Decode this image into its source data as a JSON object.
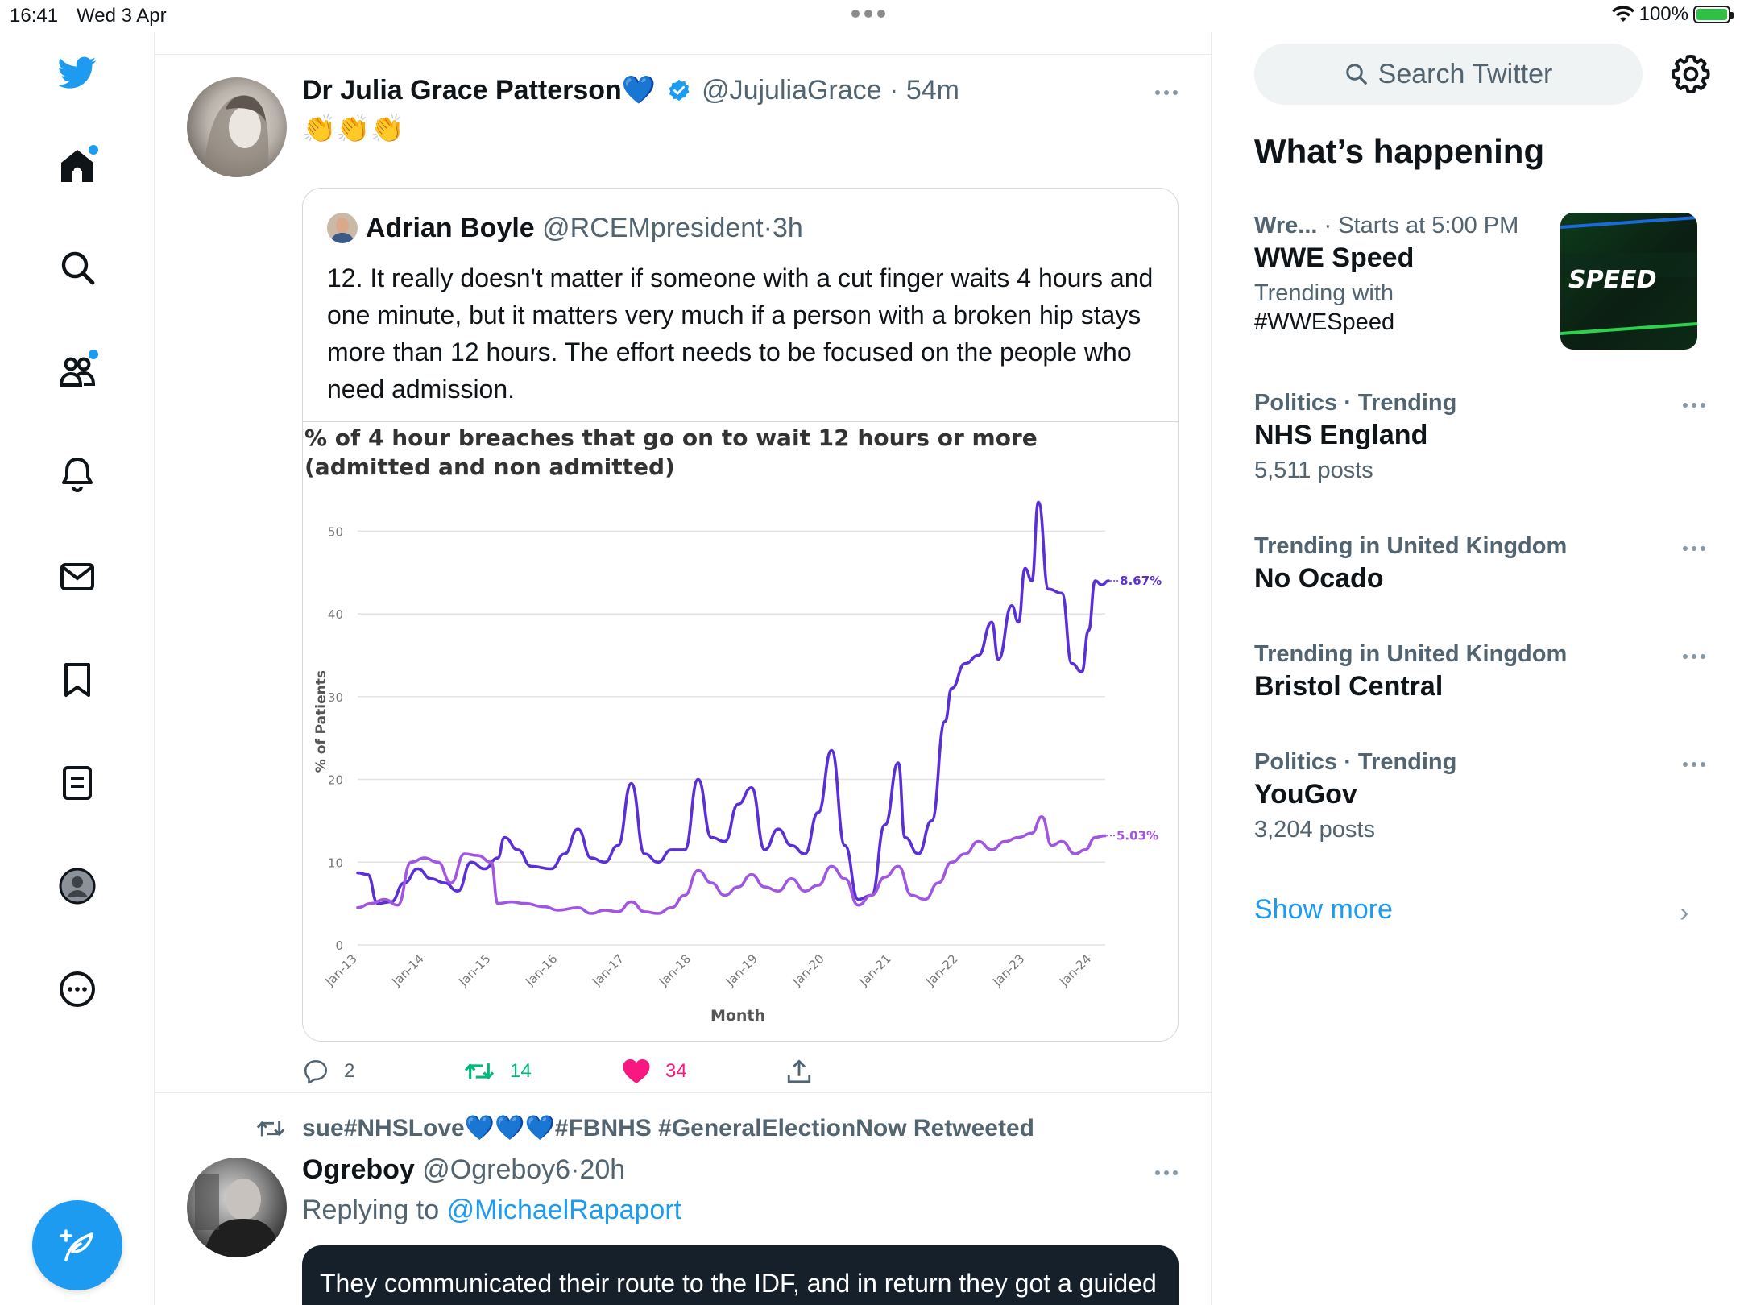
{
  "status_bar": {
    "time": "16:41",
    "date": "Wed 3 Apr",
    "battery": "100%"
  },
  "colors": {
    "accent": "#1d9bf0",
    "like": "#f91880",
    "retweet": "#00ba7c",
    "series_dark": "#5a2fd6",
    "series_light": "#a056e0"
  },
  "nav": {
    "icons": [
      "twitter-logo-icon",
      "home-icon",
      "explore-icon",
      "communities-icon",
      "notifications-icon",
      "messages-icon",
      "bookmarks-icon",
      "lists-icon",
      "profile-icon",
      "more-icon"
    ],
    "compose_icon": "compose-tweet-icon"
  },
  "tweet1": {
    "name": "Dr Julia Grace Patterson",
    "name_emoji": "💙",
    "handle": "@JujuliaGrace",
    "sep": "·",
    "time": "54m",
    "text": "👏👏👏",
    "quote": {
      "name": "Adrian Boyle",
      "handle": "@RCEMpresident",
      "sep": "·",
      "time": "3h",
      "text": "12. It really doesn't matter if someone with a cut finger waits 4 hours and one minute, but it matters very much if a person with a broken hip stays more than 12 hours. The effort needs to be focused on the people who need admission."
    },
    "actions": {
      "replies": "2",
      "retweets": "14",
      "likes": "34"
    }
  },
  "tweet2": {
    "retweeted_by": "sue#NHSLove💙💙💙#FBNHS #GeneralElectionNow Retweeted",
    "name": "Ogreboy",
    "handle": "@Ogreboy6",
    "sep": "·",
    "time": "20h",
    "replying_prefix": "Replying to",
    "replying_to": "@MichaelRapaport",
    "card_text": "They communicated their route to the IDF, and in return they got a guided munition literally straight through the logo identifying them, so"
  },
  "sidebar": {
    "search_placeholder": "Search Twitter",
    "title": "What’s happening",
    "trends": [
      {
        "meta": "Wre...",
        "meta_extra": "· Starts at 5:00 PM",
        "name": "WWE Speed",
        "sub": "Trending with",
        "sub2": "#WWESpeed",
        "image_label": "SPEED"
      },
      {
        "meta": "Politics · Trending",
        "name": "NHS England",
        "sub": "5,511 posts"
      },
      {
        "meta": "Trending in United Kingdom",
        "name": "No Ocado"
      },
      {
        "meta": "Trending in United Kingdom",
        "name": "Bristol Central"
      },
      {
        "meta": "Politics · Trending",
        "name": "YouGov",
        "sub": "3,204 posts"
      }
    ],
    "show_more": "Show more"
  },
  "chart_data": {
    "type": "line",
    "title": "% of 4 hour breaches that go on to wait 12 hours or more (admitted and non admitted)",
    "xlabel": "Month",
    "ylabel": "% of Patients",
    "ylim": [
      0,
      55
    ],
    "yticks": [
      0,
      10,
      20,
      30,
      40,
      50
    ],
    "x_tick_labels": [
      "Jan-13",
      "Jan-14",
      "Jan-15",
      "Jan-16",
      "Jan-17",
      "Jan-18",
      "Jan-19",
      "Jan-20",
      "Jan-21",
      "Jan-22",
      "Jan-23",
      "Jan-24"
    ],
    "grid": true,
    "legend": "none",
    "end_labels": [
      "8.67%",
      "5.03%"
    ],
    "series": [
      {
        "color": "#5a2fd6",
        "points": [
          [
            2013.0,
            8.7
          ],
          [
            2013.15,
            8.5
          ],
          [
            2013.3,
            5
          ],
          [
            2013.5,
            5.2
          ],
          [
            2013.7,
            7.5
          ],
          [
            2013.9,
            9.2
          ],
          [
            2014.1,
            8
          ],
          [
            2014.3,
            7.5
          ],
          [
            2014.5,
            6.5
          ],
          [
            2014.7,
            10
          ],
          [
            2014.9,
            9.2
          ],
          [
            2015.1,
            10.5
          ],
          [
            2015.2,
            13
          ],
          [
            2015.4,
            11.5
          ],
          [
            2015.6,
            9.5
          ],
          [
            2015.9,
            9.2
          ],
          [
            2016.1,
            11
          ],
          [
            2016.3,
            14
          ],
          [
            2016.5,
            10.5
          ],
          [
            2016.7,
            10
          ],
          [
            2016.9,
            12
          ],
          [
            2017.1,
            19.5
          ],
          [
            2017.3,
            11
          ],
          [
            2017.5,
            10
          ],
          [
            2017.7,
            11.5
          ],
          [
            2017.9,
            11.5
          ],
          [
            2018.1,
            20
          ],
          [
            2018.3,
            13
          ],
          [
            2018.5,
            12.5
          ],
          [
            2018.7,
            17
          ],
          [
            2018.9,
            19
          ],
          [
            2019.1,
            11.5
          ],
          [
            2019.3,
            14
          ],
          [
            2019.5,
            12
          ],
          [
            2019.7,
            11
          ],
          [
            2019.9,
            16
          ],
          [
            2020.1,
            23.5
          ],
          [
            2020.3,
            12
          ],
          [
            2020.5,
            5.5
          ],
          [
            2020.7,
            6
          ],
          [
            2020.9,
            14.5
          ],
          [
            2021.1,
            22
          ],
          [
            2021.2,
            13
          ],
          [
            2021.4,
            11
          ],
          [
            2021.6,
            15
          ],
          [
            2021.8,
            27
          ],
          [
            2021.9,
            31
          ],
          [
            2022.1,
            34
          ],
          [
            2022.3,
            35
          ],
          [
            2022.5,
            39
          ],
          [
            2022.6,
            34.5
          ],
          [
            2022.8,
            41
          ],
          [
            2022.9,
            39
          ],
          [
            2023.0,
            45.5
          ],
          [
            2023.1,
            44
          ],
          [
            2023.2,
            53.5
          ],
          [
            2023.35,
            43
          ],
          [
            2023.55,
            42.5
          ],
          [
            2023.7,
            34
          ],
          [
            2023.85,
            33
          ],
          [
            2023.95,
            38
          ],
          [
            2024.05,
            44
          ],
          [
            2024.15,
            43.5
          ],
          [
            2024.25,
            44
          ]
        ]
      },
      {
        "color": "#a056e0",
        "points": [
          [
            2013.0,
            4.5
          ],
          [
            2013.2,
            5
          ],
          [
            2013.4,
            5.5
          ],
          [
            2013.6,
            4.8
          ],
          [
            2013.8,
            10
          ],
          [
            2014.0,
            10.5
          ],
          [
            2014.2,
            10
          ],
          [
            2014.4,
            7.5
          ],
          [
            2014.6,
            11
          ],
          [
            2014.8,
            10.8
          ],
          [
            2015.0,
            10
          ],
          [
            2015.1,
            5
          ],
          [
            2015.3,
            5.2
          ],
          [
            2015.5,
            5
          ],
          [
            2015.8,
            4.6
          ],
          [
            2016.0,
            4.2
          ],
          [
            2016.3,
            4.5
          ],
          [
            2016.5,
            3.8
          ],
          [
            2016.7,
            4.2
          ],
          [
            2016.9,
            4
          ],
          [
            2017.1,
            5.2
          ],
          [
            2017.3,
            4
          ],
          [
            2017.5,
            3.8
          ],
          [
            2017.7,
            4.5
          ],
          [
            2017.9,
            6
          ],
          [
            2018.1,
            9
          ],
          [
            2018.3,
            7.5
          ],
          [
            2018.5,
            6
          ],
          [
            2018.7,
            7
          ],
          [
            2018.9,
            8.5
          ],
          [
            2019.1,
            7
          ],
          [
            2019.3,
            6.5
          ],
          [
            2019.5,
            8
          ],
          [
            2019.7,
            6.5
          ],
          [
            2019.9,
            7.2
          ],
          [
            2020.1,
            9.5
          ],
          [
            2020.3,
            8
          ],
          [
            2020.5,
            4.8
          ],
          [
            2020.7,
            6
          ],
          [
            2020.9,
            8.2
          ],
          [
            2021.1,
            9.5
          ],
          [
            2021.3,
            6
          ],
          [
            2021.5,
            5.5
          ],
          [
            2021.7,
            7.5
          ],
          [
            2021.9,
            10
          ],
          [
            2022.1,
            11
          ],
          [
            2022.3,
            12.5
          ],
          [
            2022.5,
            11.5
          ],
          [
            2022.7,
            12.5
          ],
          [
            2022.9,
            13
          ],
          [
            2023.1,
            13.5
          ],
          [
            2023.25,
            15.5
          ],
          [
            2023.4,
            12
          ],
          [
            2023.55,
            12.5
          ],
          [
            2023.75,
            11
          ],
          [
            2023.9,
            11.5
          ],
          [
            2024.05,
            13
          ],
          [
            2024.2,
            13.2
          ]
        ]
      }
    ]
  }
}
